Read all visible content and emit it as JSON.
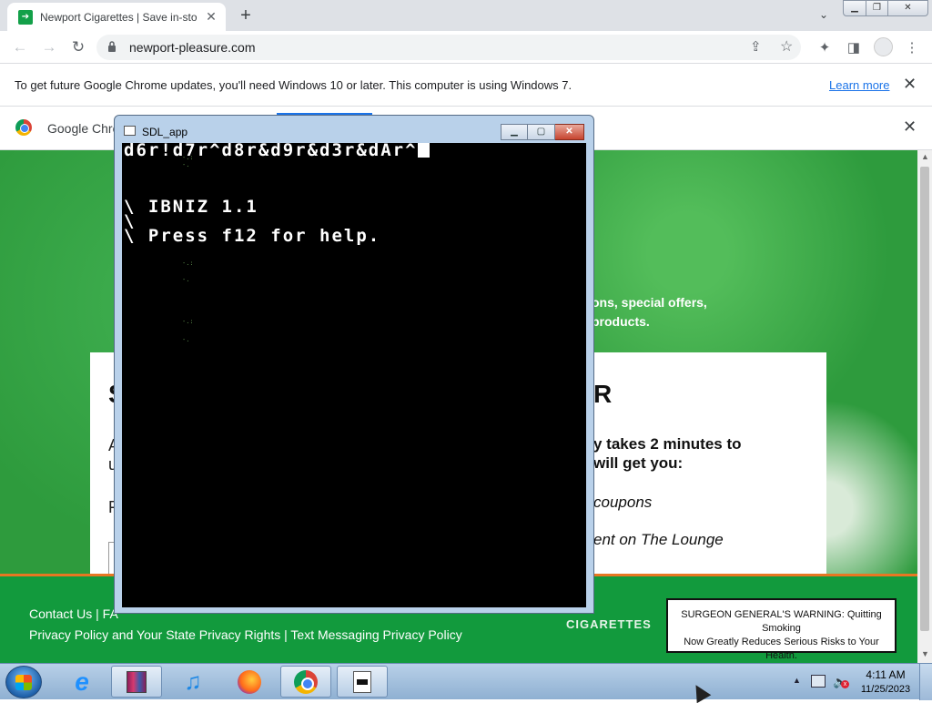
{
  "browser": {
    "tab_title": "Newport Cigarettes | Save in-sto",
    "tab_close": "✕",
    "new_tab": "+",
    "tab_search": "⌄",
    "url": "newport-pleasure.com"
  },
  "infobar": {
    "message": "To get future Google Chrome updates, you'll need Windows 10 or later. This computer is using Windows 7.",
    "learn_more": "Learn more",
    "close": "✕"
  },
  "promobar": {
    "text": "Google Chro",
    "close": "✕"
  },
  "webpage": {
    "lead_line1": "ons, special offers,",
    "lead_line2": "products.",
    "card": {
      "heading_left": "S",
      "heading_right": "R",
      "left_a": "A",
      "left_u": "u",
      "left_f": "F",
      "right_line1": "y takes 2 minutes to",
      "right_line2": "will get you:",
      "right_item1": "coupons",
      "right_item2": "ent on The Lounge"
    },
    "footer": {
      "links_row1": "Contact Us  |  FA",
      "links_row2": "Privacy Policy and Your State Privacy Rights  |  Text Messaging Privacy Policy",
      "brand": "CIGARETTES",
      "warning_line1": "SURGEON GENERAL'S WARNING: Quitting Smoking",
      "warning_line2": "Now Greatly Reduces Serious Risks to Your Health."
    }
  },
  "sdl_window": {
    "title": "SDL_app",
    "min": "▁",
    "max": "▢",
    "close": "✕",
    "console_lines": [
      "d6r!d7r^d8r&d9r&d3r&dAr^",
      "\\ IBNIZ 1.1",
      "\\",
      "\\ Press f12 for help."
    ]
  },
  "taskbar": {
    "ie_glyph": "e",
    "itunes_glyph": "♫",
    "tray_up": "▲",
    "vol": "🔈",
    "vol_x": "x",
    "time": "4:11 AM",
    "date": "11/25/2023"
  },
  "colors": {
    "page_green": "#2e9b3d",
    "footer_green": "#129a3d",
    "footer_accent": "#e87722",
    "link_blue": "#1a73e8"
  }
}
